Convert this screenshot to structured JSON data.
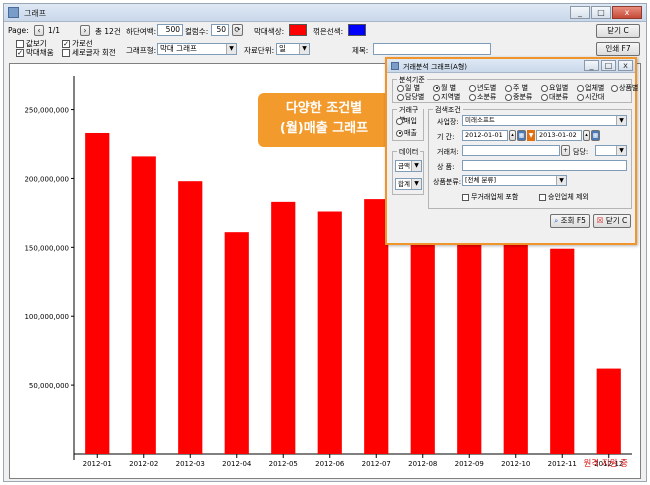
{
  "window": {
    "title": "그래프",
    "min": "_",
    "max": "□",
    "close": "x"
  },
  "toolbar": {
    "page_label": "Page:",
    "page_value": "1/1",
    "total_label": "총 12건",
    "bottom_margin_label": "하단여백:",
    "bottom_margin_value": "500",
    "column_label": "컬럼수:",
    "column_value": "50",
    "bar_color_label": "막대색상:",
    "line_color_label": "꺾은선색:",
    "bar_color": "#ff0000",
    "line_color": "#0000ff",
    "close_label": "닫기 C",
    "print_label": "인쇄 F7",
    "chk_value": "값보기",
    "chk_horizontal": "가로선",
    "chk_bar_fill": "막대채움",
    "chk_vertical_rotate": "세로글자 회전",
    "graph_type_label": "그래프형:",
    "graph_type_value": "막대 그래프",
    "unit_label": "자료단위:",
    "unit_value": "일",
    "subject_label": "제목:"
  },
  "chart_data": {
    "type": "bar",
    "categories": [
      "2012-01",
      "2012-02",
      "2012-03",
      "2012-04",
      "2012-05",
      "2012-06",
      "2012-07",
      "2012-08",
      "2012-09",
      "2012-10",
      "2012-11",
      "2012-12"
    ],
    "values": [
      233000000,
      216000000,
      198000000,
      161000000,
      183000000,
      176000000,
      185000000,
      185000000,
      185000000,
      185000000,
      149000000,
      62000000
    ],
    "yticks": [
      "50,000,000",
      "100,000,000",
      "150,000,000",
      "200,000,000",
      "250,000,000"
    ],
    "ytick_values": [
      50000000,
      100000000,
      150000000,
      200000000,
      250000000
    ],
    "ylim": [
      0,
      270000000
    ],
    "bar_color": "#ff0000",
    "grid": false
  },
  "popup": {
    "title": "거래분석 그래프(A형)",
    "basis_title": "분석기준",
    "basis_options": [
      "일 별",
      "월 별",
      "년도별",
      "주 별",
      "요일별",
      "업체별",
      "상품별",
      "담당별",
      "지역별",
      "소분류",
      "중분류",
      "대분류",
      "시간대"
    ],
    "basis_selected": 1,
    "trade_title": "거래구분",
    "trade_options": [
      "매입",
      "매출"
    ],
    "trade_selected": 1,
    "data_title": "데이터",
    "data_sel1": "금액",
    "data_sel2": "합계",
    "search_title": "검색조건",
    "site_label": "사업장:",
    "site_value": "미래소프트",
    "period_label": "기 간:",
    "date_from": "2012-01-01",
    "date_to": "2013-01-02",
    "vendor_label": "거래처:",
    "manager_label": "담당:",
    "product_label": "상 품:",
    "category_label": "상품분류:",
    "category_value": "[전체 분류]",
    "chk_no_trade": "무거래업체 포함",
    "chk_approved": "승인업체 제외",
    "search_btn": "조회 F5",
    "close_btn": "닫기 C"
  },
  "callout": {
    "line1": "다양한 조건별",
    "line2": "(월)매출 그래프"
  },
  "status": {
    "remote": "원격 지원 중"
  }
}
